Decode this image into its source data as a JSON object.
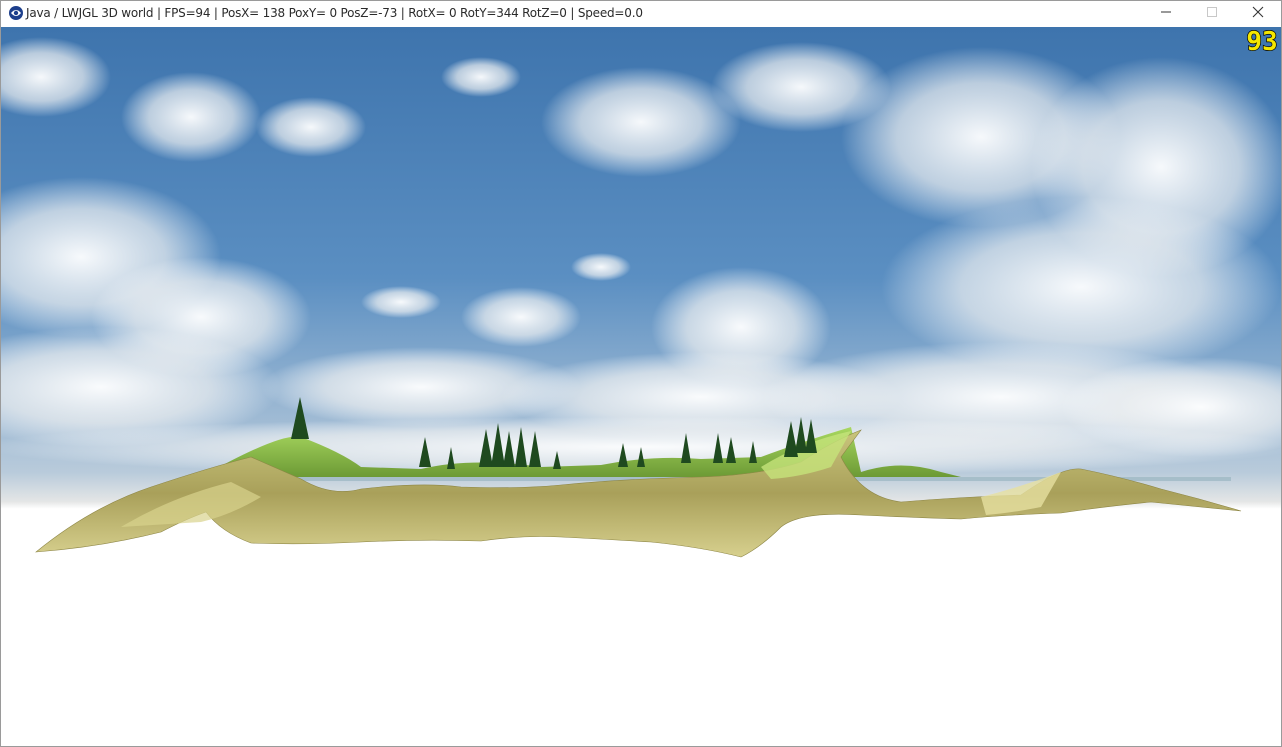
{
  "window": {
    "title": "Java / LWJGL 3D world | FPS=94 | PosX= 138 PoxY= 0 PosZ=-73 | RotX= 0 RotY=344 RotZ=0 | Speed=0.0",
    "app_icon": "java-app-icon",
    "controls": {
      "minimize_icon": "minimize-icon",
      "maximize_icon": "maximize-icon",
      "close_icon": "close-icon"
    }
  },
  "hud": {
    "fps_overlay": "93",
    "fps_color": "#f5e600"
  },
  "scene": {
    "sky_top_color": "#3f78b4",
    "sky_horizon_color": "#d9dfe4",
    "ground_color": "#ffffff",
    "terrain_color": "#b8b060",
    "grass_color": "#8fc44a",
    "tree_color": "#1f4a1f",
    "water_color": "#9fb9c4"
  }
}
